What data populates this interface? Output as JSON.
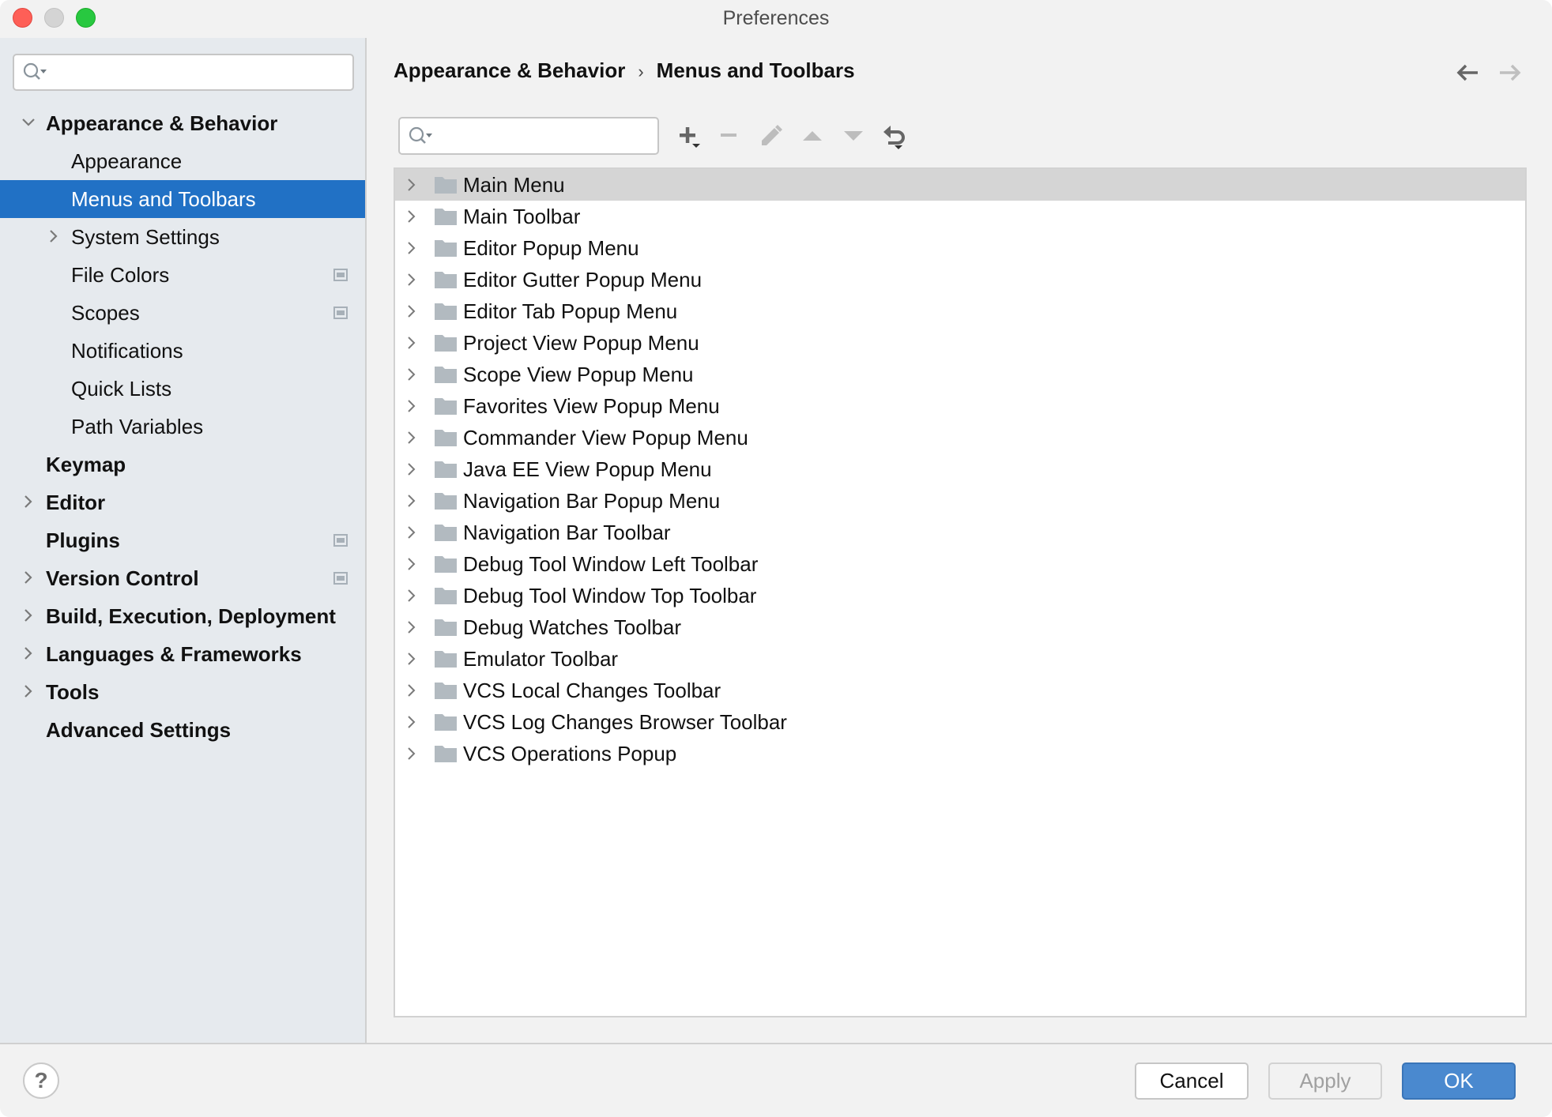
{
  "window": {
    "title": "Preferences"
  },
  "sidebar": {
    "search": {
      "value": "",
      "placeholder": ""
    },
    "items": [
      {
        "label": "Appearance & Behavior",
        "level": 0,
        "bold": true,
        "expander": "expanded",
        "badge": false,
        "selected": false
      },
      {
        "label": "Appearance",
        "level": 1,
        "bold": false,
        "expander": "none",
        "badge": false,
        "selected": false
      },
      {
        "label": "Menus and Toolbars",
        "level": 1,
        "bold": false,
        "expander": "none",
        "badge": false,
        "selected": true
      },
      {
        "label": "System Settings",
        "level": 1,
        "bold": false,
        "expander": "collapsed",
        "badge": false,
        "selected": false
      },
      {
        "label": "File Colors",
        "level": 1,
        "bold": false,
        "expander": "none",
        "badge": true,
        "selected": false
      },
      {
        "label": "Scopes",
        "level": 1,
        "bold": false,
        "expander": "none",
        "badge": true,
        "selected": false
      },
      {
        "label": "Notifications",
        "level": 1,
        "bold": false,
        "expander": "none",
        "badge": false,
        "selected": false
      },
      {
        "label": "Quick Lists",
        "level": 1,
        "bold": false,
        "expander": "none",
        "badge": false,
        "selected": false
      },
      {
        "label": "Path Variables",
        "level": 1,
        "bold": false,
        "expander": "none",
        "badge": false,
        "selected": false
      },
      {
        "label": "Keymap",
        "level": 0,
        "bold": true,
        "expander": "none",
        "badge": false,
        "selected": false
      },
      {
        "label": "Editor",
        "level": 0,
        "bold": true,
        "expander": "collapsed",
        "badge": false,
        "selected": false
      },
      {
        "label": "Plugins",
        "level": 0,
        "bold": true,
        "expander": "none",
        "badge": true,
        "selected": false
      },
      {
        "label": "Version Control",
        "level": 0,
        "bold": true,
        "expander": "collapsed",
        "badge": true,
        "selected": false
      },
      {
        "label": "Build, Execution, Deployment",
        "level": 0,
        "bold": true,
        "expander": "collapsed",
        "badge": false,
        "selected": false
      },
      {
        "label": "Languages & Frameworks",
        "level": 0,
        "bold": true,
        "expander": "collapsed",
        "badge": false,
        "selected": false
      },
      {
        "label": "Tools",
        "level": 0,
        "bold": true,
        "expander": "collapsed",
        "badge": false,
        "selected": false
      },
      {
        "label": "Advanced Settings",
        "level": 0,
        "bold": true,
        "expander": "none",
        "badge": false,
        "selected": false
      }
    ]
  },
  "main": {
    "breadcrumb": {
      "parent": "Appearance & Behavior",
      "separator": "›",
      "current": "Menus and Toolbars"
    },
    "nav": {
      "back_icon": "arrow-left-icon",
      "forward_icon": "arrow-right-icon",
      "forward_enabled": false
    },
    "search": {
      "value": "",
      "placeholder": ""
    },
    "toolbar": [
      {
        "name": "add",
        "icon": "plus-icon",
        "enabled": true,
        "has_dropdown": true
      },
      {
        "name": "remove",
        "icon": "minus-icon",
        "enabled": false,
        "has_dropdown": false
      },
      {
        "name": "edit",
        "icon": "pencil-icon",
        "enabled": false,
        "has_dropdown": false
      },
      {
        "name": "move-up",
        "icon": "triangle-up-icon",
        "enabled": false,
        "has_dropdown": false
      },
      {
        "name": "move-down",
        "icon": "triangle-down-icon",
        "enabled": false,
        "has_dropdown": false
      },
      {
        "name": "restore",
        "icon": "restore-icon",
        "enabled": true,
        "has_dropdown": true
      }
    ],
    "tree": [
      {
        "label": "Main Menu",
        "selected": true
      },
      {
        "label": "Main Toolbar",
        "selected": false
      },
      {
        "label": "Editor Popup Menu",
        "selected": false
      },
      {
        "label": "Editor Gutter Popup Menu",
        "selected": false
      },
      {
        "label": "Editor Tab Popup Menu",
        "selected": false
      },
      {
        "label": "Project View Popup Menu",
        "selected": false
      },
      {
        "label": "Scope View Popup Menu",
        "selected": false
      },
      {
        "label": "Favorites View Popup Menu",
        "selected": false
      },
      {
        "label": "Commander View Popup Menu",
        "selected": false
      },
      {
        "label": "Java EE View Popup Menu",
        "selected": false
      },
      {
        "label": "Navigation Bar Popup Menu",
        "selected": false
      },
      {
        "label": "Navigation Bar Toolbar",
        "selected": false
      },
      {
        "label": "Debug Tool Window Left Toolbar",
        "selected": false
      },
      {
        "label": "Debug Tool Window Top Toolbar",
        "selected": false
      },
      {
        "label": "Debug Watches Toolbar",
        "selected": false
      },
      {
        "label": "Emulator Toolbar",
        "selected": false
      },
      {
        "label": "VCS Local Changes Toolbar",
        "selected": false
      },
      {
        "label": "VCS Log Changes Browser Toolbar",
        "selected": false
      },
      {
        "label": "VCS Operations Popup",
        "selected": false
      }
    ]
  },
  "footer": {
    "help_label": "?",
    "cancel_label": "Cancel",
    "apply_label": "Apply",
    "apply_enabled": false,
    "ok_label": "OK"
  },
  "colors": {
    "selection_blue": "#2171c5",
    "ok_blue": "#4a89cf",
    "sidebar_bg": "#e6eaee",
    "tree_selected_bg": "#d5d5d5",
    "folder_gray": "#b2bac0",
    "close_red": "#fe5f57",
    "maximize_green": "#28c840"
  }
}
